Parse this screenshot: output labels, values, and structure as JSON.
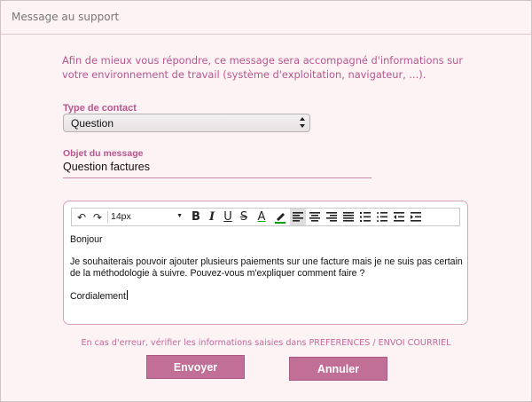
{
  "window": {
    "title": "Message au support"
  },
  "intro": {
    "text": "Afin de mieux vous répondre, ce message sera accompagné d'informations sur votre environnement de travail (système d'exploitation, navigateur, ...)."
  },
  "contact_type": {
    "label": "Type de contact",
    "selected": "Question"
  },
  "subject": {
    "label": "Objet du message",
    "value": "Question factures"
  },
  "editor": {
    "toolbar": {
      "undo": "↶",
      "redo": "↷",
      "font_size": "14px",
      "bold": "B",
      "italic": "I",
      "underline": "U",
      "strike": "S",
      "font_color": "A"
    },
    "body": {
      "greeting": "Bonjour",
      "message": "Je souhaiterais pouvoir ajouter plusieurs paiements sur une facture mais je ne suis pas certain de la méthodologie à suivre. Pouvez-vous m'expliquer comment faire ?",
      "closing": "Cordialement"
    }
  },
  "error_note": "En cas d'erreur, vérifier les informations saisies dans PREFERENCES / ENVOI COURRIEL",
  "buttons": {
    "send": "Envoyer",
    "cancel": "Annuler"
  },
  "colors": {
    "accent": "#b8578e",
    "button": "#c16f97",
    "background": "#fdf2f4"
  }
}
